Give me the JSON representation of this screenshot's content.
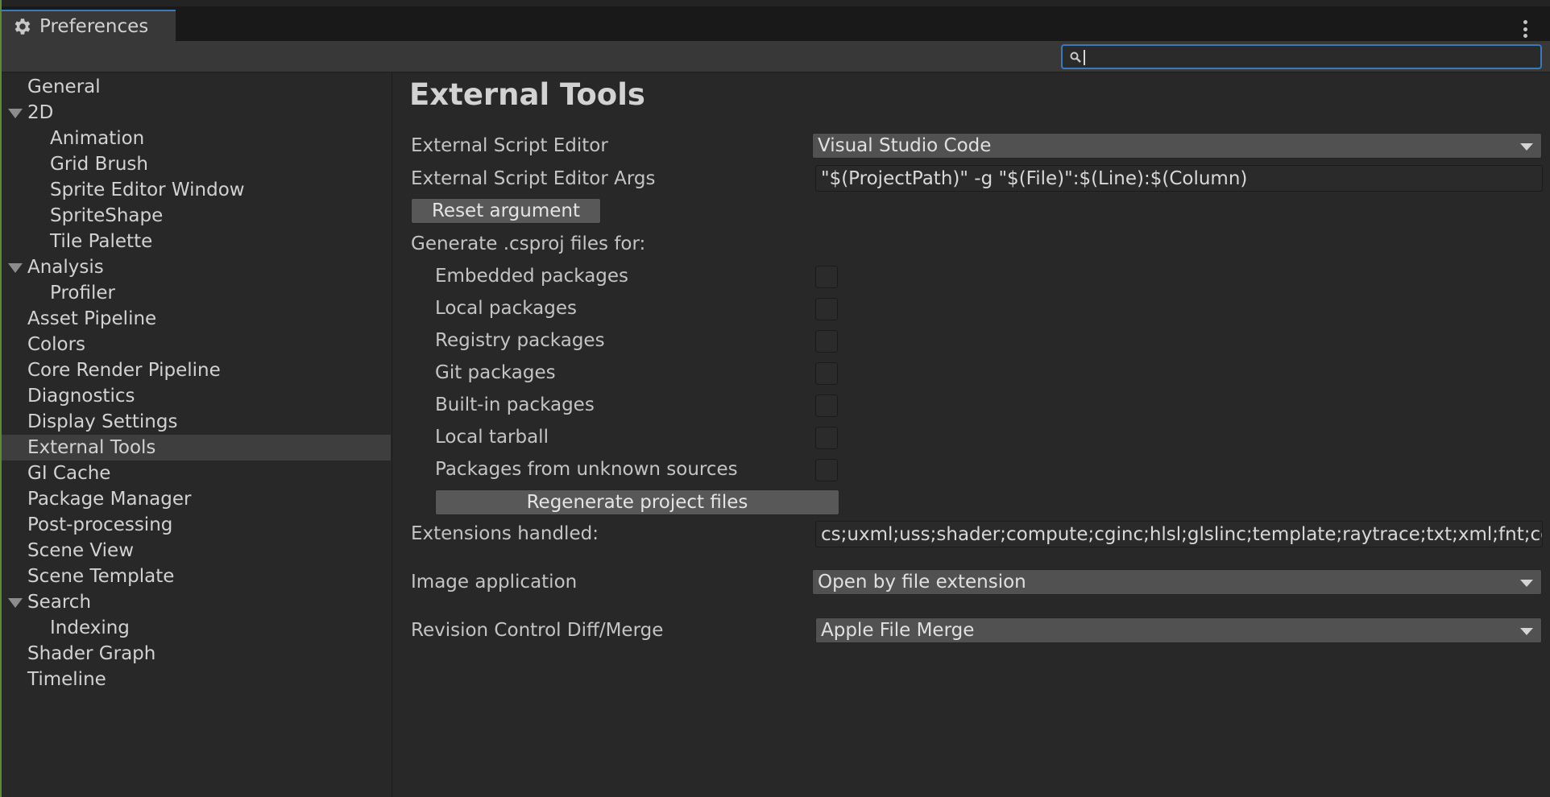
{
  "window": {
    "tab_title": "Preferences",
    "tab_icon": "gear-icon",
    "menu_icon": "kebab-menu-icon"
  },
  "search": {
    "value": "",
    "placeholder": ""
  },
  "sidebar": {
    "items": [
      {
        "label": "General"
      },
      {
        "label": "2D"
      },
      {
        "label": "Animation"
      },
      {
        "label": "Grid Brush"
      },
      {
        "label": "Sprite Editor Window"
      },
      {
        "label": "SpriteShape"
      },
      {
        "label": "Tile Palette"
      },
      {
        "label": "Analysis"
      },
      {
        "label": "Profiler"
      },
      {
        "label": "Asset Pipeline"
      },
      {
        "label": "Colors"
      },
      {
        "label": "Core Render Pipeline"
      },
      {
        "label": "Diagnostics"
      },
      {
        "label": "Display Settings"
      },
      {
        "label": "External Tools"
      },
      {
        "label": "GI Cache"
      },
      {
        "label": "Package Manager"
      },
      {
        "label": "Post-processing"
      },
      {
        "label": "Scene View"
      },
      {
        "label": "Scene Template"
      },
      {
        "label": "Search"
      },
      {
        "label": "Indexing"
      },
      {
        "label": "Shader Graph"
      },
      {
        "label": "Timeline"
      }
    ],
    "selected": "External Tools"
  },
  "main": {
    "title": "External Tools",
    "script_editor_label": "External Script Editor",
    "script_editor_value": "Visual Studio Code",
    "script_args_label": "External Script Editor Args",
    "script_args_value": "\"$(ProjectPath)\" -g \"$(File)\":$(Line):$(Column)",
    "reset_button": "Reset argument",
    "csproj_label": "Generate .csproj files for:",
    "packages": [
      {
        "label": "Embedded packages",
        "checked": false
      },
      {
        "label": "Local packages",
        "checked": false
      },
      {
        "label": "Registry packages",
        "checked": false
      },
      {
        "label": "Git packages",
        "checked": false
      },
      {
        "label": "Built-in packages",
        "checked": false
      },
      {
        "label": "Local tarball",
        "checked": false
      },
      {
        "label": "Packages from unknown sources",
        "checked": false
      }
    ],
    "regenerate_button": "Regenerate project files",
    "extensions_label": "Extensions handled:",
    "extensions_value": "cs;uxml;uss;shader;compute;cginc;hlsl;glslinc;template;raytrace;txt;xml;fnt;cd;asmdef;rsp;asmref",
    "image_app_label": "Image application",
    "image_app_value": "Open by file extension",
    "diff_label": "Revision Control Diff/Merge",
    "diff_value": "Apple File Merge"
  },
  "colors": {
    "accent": "#3a79bb",
    "background": "#282828",
    "selected_row": "#3e3e3e"
  }
}
